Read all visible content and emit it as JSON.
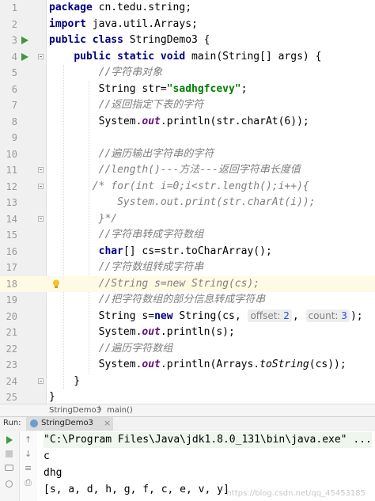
{
  "editor": {
    "lines": [
      {
        "n": "1",
        "tokens": [
          {
            "t": "package",
            "c": "kw"
          },
          {
            "t": " cn.tedu.string;",
            "c": ""
          }
        ]
      },
      {
        "n": "2",
        "tokens": [
          {
            "t": "import",
            "c": "kw"
          },
          {
            "t": " java.util.Arrays;",
            "c": ""
          }
        ]
      },
      {
        "n": "3",
        "tokens": [
          {
            "t": "public class",
            "c": "kw"
          },
          {
            "t": " StringDemo3 {",
            "c": ""
          }
        ]
      },
      {
        "n": "4",
        "tokens": [
          {
            "t": "    "
          },
          {
            "t": "public static void",
            "c": "kw"
          },
          {
            "t": " main(String[] args) {",
            "c": ""
          }
        ]
      },
      {
        "n": "5",
        "tokens": [
          {
            "t": "        "
          },
          {
            "t": "//字符串对象",
            "c": "cm"
          }
        ]
      },
      {
        "n": "6",
        "tokens": [
          {
            "t": "        String str="
          },
          {
            "t": "\"sadhgfcevy\"",
            "c": "str"
          },
          {
            "t": ";"
          }
        ]
      },
      {
        "n": "7",
        "tokens": [
          {
            "t": "        "
          },
          {
            "t": "//返回指定下表的字符",
            "c": "cm"
          }
        ]
      },
      {
        "n": "8",
        "tokens": [
          {
            "t": "        System."
          },
          {
            "t": "out",
            "c": "fld"
          },
          {
            "t": ".println(str.charAt(6));"
          }
        ]
      },
      {
        "n": "9",
        "tokens": []
      },
      {
        "n": "10",
        "tokens": [
          {
            "t": "        "
          },
          {
            "t": "//遍历输出字符串的字符",
            "c": "cm"
          }
        ]
      },
      {
        "n": "11",
        "tokens": [
          {
            "t": "        "
          },
          {
            "t": "//length()---方法---返回字符串长度值",
            "c": "cm"
          }
        ]
      },
      {
        "n": "12",
        "tokens": [
          {
            "t": "       "
          },
          {
            "t": "/* for(int i=0;i<str.length();i++){",
            "c": "cm"
          }
        ]
      },
      {
        "n": "13",
        "tokens": [
          {
            "t": "           "
          },
          {
            "t": "System.out.print(str.charAt(i));",
            "c": "cm"
          }
        ]
      },
      {
        "n": "14",
        "tokens": [
          {
            "t": "        "
          },
          {
            "t": "}*/",
            "c": "cm"
          }
        ]
      },
      {
        "n": "15",
        "tokens": [
          {
            "t": "        "
          },
          {
            "t": "//字符串转成字符数组",
            "c": "cm"
          }
        ]
      },
      {
        "n": "16",
        "tokens": [
          {
            "t": "        "
          },
          {
            "t": "char",
            "c": "kw"
          },
          {
            "t": "[] cs=str.toCharArray();"
          }
        ]
      },
      {
        "n": "17",
        "tokens": [
          {
            "t": "        "
          },
          {
            "t": "//字符数组转成字符串",
            "c": "cm"
          }
        ]
      },
      {
        "n": "18",
        "tokens": [
          {
            "t": "        "
          },
          {
            "t": "//String s=new String(cs);",
            "c": "cm"
          }
        ]
      },
      {
        "n": "19",
        "tokens": [
          {
            "t": "        "
          },
          {
            "t": "//把字符数组的部分信息转成字符串",
            "c": "cm"
          }
        ]
      },
      {
        "n": "20",
        "tokens": [
          {
            "t": "        String s="
          },
          {
            "t": "new",
            "c": "kw"
          },
          {
            "t": " String(cs, "
          },
          {
            "t": "offset: ",
            "c": "hint",
            "v": "2"
          },
          {
            "t": ", "
          },
          {
            "t": "count: ",
            "c": "hint",
            "v": "3"
          },
          {
            "t": ");"
          }
        ]
      },
      {
        "n": "21",
        "tokens": [
          {
            "t": "        System."
          },
          {
            "t": "out",
            "c": "fld"
          },
          {
            "t": ".println(s);"
          }
        ]
      },
      {
        "n": "22",
        "tokens": [
          {
            "t": "        "
          },
          {
            "t": "//遍历字符数组",
            "c": "cm"
          }
        ]
      },
      {
        "n": "23",
        "tokens": [
          {
            "t": "        System."
          },
          {
            "t": "out",
            "c": "fld"
          },
          {
            "t": ".println(Arrays."
          },
          {
            "t": "toString",
            "c": "st"
          },
          {
            "t": "(cs));"
          }
        ]
      },
      {
        "n": "24",
        "tokens": [
          {
            "t": "    }"
          }
        ]
      },
      {
        "n": "25",
        "tokens": [
          {
            "t": "}"
          }
        ]
      }
    ],
    "current_line": 18,
    "run_markers": [
      3,
      4
    ]
  },
  "breadcrumb": {
    "class_name": "StringDemo3",
    "separator": "〉",
    "method": "main()"
  },
  "run_panel": {
    "label": "Run:",
    "tab_label": "StringDemo3",
    "close": "×"
  },
  "console": {
    "lines": [
      "\"C:\\Program Files\\Java\\jdk1.8.0_131\\bin\\java.exe\" ...",
      "c",
      "dhg",
      "[s, a, d, h, g, f, c, e, v, y]"
    ]
  },
  "watermark": "https://blog.csdn.net/qq_45453185",
  "colors": {
    "keyword": "#000080",
    "string": "#008000",
    "comment": "#808080",
    "field": "#660e7a",
    "current_line": "#fffae3",
    "run_icon": "#3a9b3a"
  }
}
